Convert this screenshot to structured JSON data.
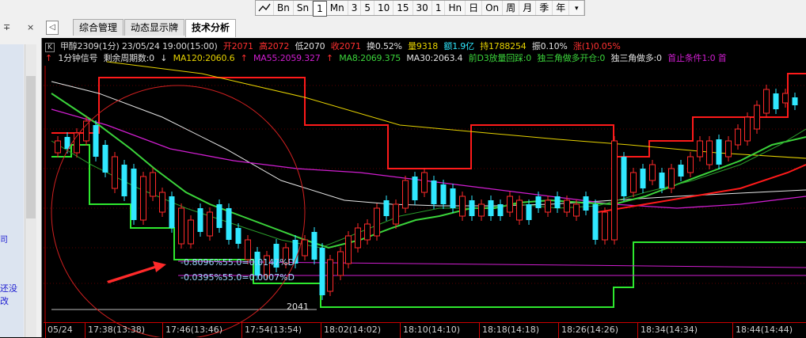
{
  "toolbar": {
    "periods": [
      "Sn",
      "1",
      "Mn",
      "3",
      "5",
      "10",
      "15",
      "30",
      "1",
      "Hn",
      "日",
      "On",
      "周",
      "月",
      "季",
      "年"
    ],
    "prefix_labels": [
      "Bn"
    ],
    "active": "1",
    "more": "▾"
  },
  "left_panel": {
    "pin": "∓",
    "close": "×",
    "text1": "司",
    "text2": "还没改"
  },
  "tabs": {
    "nav": "◁",
    "items": [
      "综合管理",
      "动态显示牌",
      "技术分析"
    ],
    "active": "技术分析"
  },
  "header": {
    "k_label": "K",
    "title": "甲醇2309(1分) 23/05/24 19:00(15:00)",
    "open": "开2071",
    "high": "高2072",
    "low": "低2070",
    "close": "收2071",
    "turnover": "换0.52%",
    "volume": "量9318",
    "amount": "额1.9亿",
    "hold": "持1788254",
    "amplitude": "振0.10%",
    "change": "涨(1)0.05%"
  },
  "indicators": {
    "signal": "1分钟信号",
    "remain": "剩余周期数:0",
    "ma120": "MA120:2060.6",
    "ma55": "MA55:2059.327",
    "ma8": "MA8:2069.375",
    "ma30": "MA30:2063.4",
    "d3": "前D3放量回踩:0",
    "tri_open": "独三角做多开仓:0",
    "tri_long": "独三角做多:0",
    "stop": "首止条件1:0 首"
  },
  "annotations": {
    "pct1": "-0.8096%55.0=0.0147%D",
    "pct2": "-0.0395%55.0=0.0007%D",
    "low_price": "2041"
  },
  "time_axis": [
    "05/24",
    "17:38(13:38)",
    "17:46(13:46)",
    "17:54(13:54)",
    "18:02(14:02)",
    "18:10(14:10)",
    "18:18(14:18)",
    "18:26(14:26)",
    "18:34(14:34)",
    "18:44(14:44)"
  ],
  "colors": {
    "up": "#ff2a2a",
    "down": "#30e8ff",
    "ma8": "#3bd43b",
    "ma30": "#e6e6e6",
    "ma55": "#d01ed0",
    "ma120": "#e6d200",
    "band_upper": "#ff1a1a",
    "band_lower": "#2ee82e",
    "arrow": "#ff2a2a"
  }
}
